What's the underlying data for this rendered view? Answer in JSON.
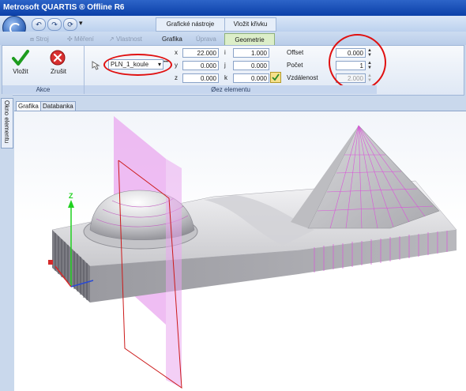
{
  "window": {
    "title": "Metrosoft QUARTIS ® Offline R6"
  },
  "quick_access": {
    "undo_icon": "undo-icon",
    "redo_icon": "redo-icon",
    "dropdown_glyph": "▾"
  },
  "context_tabs": [
    "Grafické nástroje",
    "Vložit křivku"
  ],
  "tabs": [
    {
      "label": "Stroj",
      "enabled": false
    },
    {
      "label": "Měření",
      "enabled": false
    },
    {
      "label": "Vlastnost",
      "enabled": false
    },
    {
      "label": "Grafika",
      "enabled": true
    },
    {
      "label": "Úprava",
      "enabled": false
    },
    {
      "label": "Geometrie",
      "enabled": true,
      "active": true
    }
  ],
  "actions": {
    "confirm_label": "Vložit",
    "cancel_label": "Zrušit",
    "group_label": "Akce"
  },
  "section": {
    "plane_select": "PLN_1_koule",
    "more_glyph": "•••",
    "x_label": "x",
    "x_value": "22.000",
    "y_label": "y",
    "y_value": "0.000",
    "z_label": "z",
    "z_value": "0.000",
    "i_label": "i",
    "i_value": "1.000",
    "j_label": "j",
    "j_value": "0.000",
    "k_label": "k",
    "k_value": "0.000",
    "offset_label": "Offset",
    "offset_value": "0.000",
    "count_label": "Počet",
    "count_value": "1",
    "distance_label": "Vzdálenost",
    "distance_value": "2.000",
    "group_label": "Øez elementu"
  },
  "side_panel": {
    "label": "Okno elementu"
  },
  "doc_tabs": [
    {
      "label": "Grafika",
      "active": true
    },
    {
      "label": "Databanka",
      "active": false
    }
  ],
  "viewport": {
    "axis_z_label": "Z"
  },
  "colors": {
    "highlight": "#e01010",
    "section_plane": "#e060e0",
    "axis_green": "#1fd11f"
  }
}
